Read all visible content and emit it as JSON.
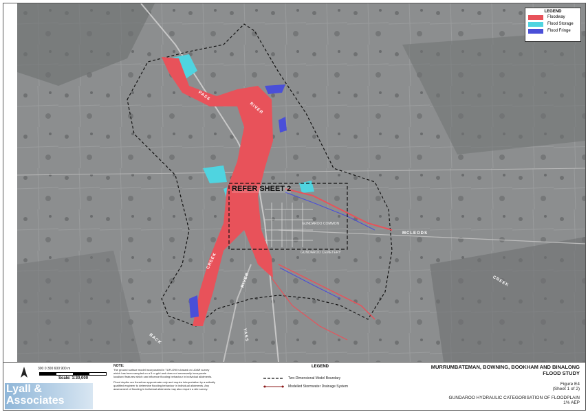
{
  "legend": {
    "title": "LEGEND",
    "items": [
      {
        "label": "Floodway",
        "color": "#e8525a"
      },
      {
        "label": "Flood Storage",
        "color": "#4fd4e0"
      },
      {
        "label": "Flood Fringe",
        "color": "#4a4fd8"
      }
    ]
  },
  "map": {
    "refer_label": "REFER SHEET 2",
    "labels": {
      "pass": "PASS",
      "river_top": "RIVER",
      "creek": "CREEK",
      "river_mid": "RIVER",
      "yass": "YASS",
      "back": "BACK",
      "mcleods": "MCLEODS",
      "creek_right": "CREEK",
      "gundaroo_common": "GUNDAROO COMMON",
      "gundaroo_cemetery": "GUNDAROO CEMETERY"
    }
  },
  "footer": {
    "scale_ticks": "300   0   300   600   900 m",
    "scale_label": "Scale: 1:30,000",
    "note_title": "NOTE:",
    "note_text1": "The ground surface model incorporated in TUFLOW is based on LiDAR survey which has been sampled on a 5 m grid and does not necessarily incorporate localised features which can influence flooding behaviour in individual allotments.",
    "note_text2": "Flood depths are therefore approximate only and require interpretation by a suitably qualified engineer to determine flooding behaviour in individual allotments. Any assessment of flooding in individual allotments may also require a site survey.",
    "legend_title": "LEGEND",
    "legend_boundary": "Two-Dimensional Model Boundary",
    "legend_drainage": "Modelled Stormwater Drainage System",
    "logo_line1": "Lyall &",
    "logo_line2": "Associates",
    "title_line1": "MURRUMBATEMAN, BOWNING, BOOKHAM AND BINALONG",
    "title_line2": "FLOOD STUDY",
    "figure": "Figure E4",
    "sheet": "(Sheet 1 of 2)",
    "subtitle": "GUNDAROO HYDRAULIC CATEGORISATION OF FLOODPLAIN",
    "aep": "1% AEP"
  }
}
